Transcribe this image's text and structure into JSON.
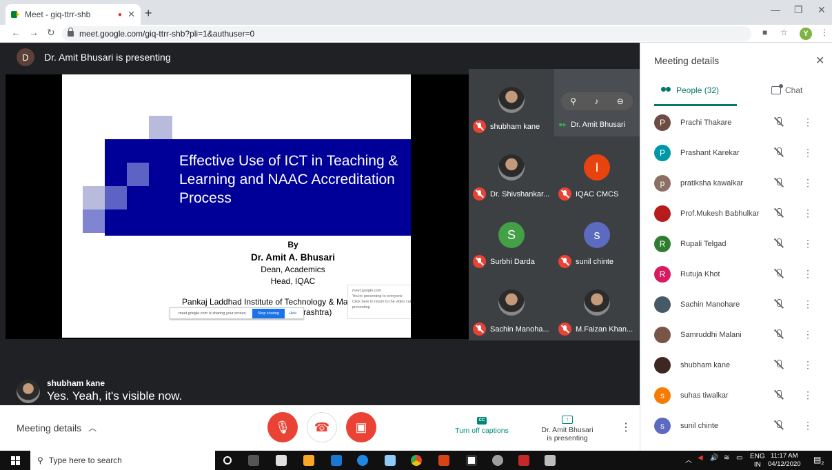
{
  "browser": {
    "tab_title": "Meet - giq-ttrr-shb",
    "url": "meet.google.com/giq-ttrr-shb?pli=1&authuser=0",
    "avatar_letter": "Y"
  },
  "meeting": {
    "presenter_initial": "D",
    "presenter_text": "Dr. Amit Bhusari is presenting"
  },
  "slide": {
    "title": "Effective Use of ICT in Teaching & Learning and NAAC Accreditation Process",
    "by": "By",
    "author": "Dr. Amit A. Bhusari",
    "role1": "Dean, Academics",
    "role2": "Head, IQAC",
    "institute": "Pankaj Laddhad Institute of Technology & Man",
    "institute_tail": "rashtra)",
    "share_text": "meet.google.com is sharing your screen.",
    "stop_label": "Stop sharing",
    "hide_label": "Hide",
    "popup_site": "meet.google.com",
    "popup_line1": "You're presenting to everyone",
    "popup_line2": "Click here to return to the video call when you're ready to stop presenting"
  },
  "tiles": [
    {
      "name": "shubham kane",
      "initial": "",
      "color": "photo"
    },
    {
      "name": "Dr. Amit Bhusari",
      "initial": "",
      "color": "speaker"
    },
    {
      "name": "Dr. Shivshankar...",
      "initial": "",
      "color": "photo"
    },
    {
      "name": "IQAC CMCS",
      "initial": "I",
      "color": "#e8430f"
    },
    {
      "name": "Surbhi Darda",
      "initial": "S",
      "color": "#43a047"
    },
    {
      "name": "sunil chinte",
      "initial": "s",
      "color": "#5c6bc0"
    },
    {
      "name": "Sachin Manoha...",
      "initial": "",
      "color": "photo"
    },
    {
      "name": "M.Faizan Khan...",
      "initial": "",
      "color": "photo"
    }
  ],
  "caption": {
    "speaker": "shubham kane",
    "text": "Yes. Yeah, it's visible now."
  },
  "controls": {
    "meeting_details": "Meeting details",
    "captions_label": "Turn off captions",
    "cc_icon": "CC",
    "presenting_line1": "Dr. Amit Bhusari",
    "presenting_line2": "is presenting"
  },
  "panel": {
    "title": "Meeting details",
    "people_tab": "People (32)",
    "chat_tab": "Chat",
    "people": [
      {
        "name": "Prachi Thakare",
        "initial": "P",
        "color": "#6d4c41"
      },
      {
        "name": "Prashant Karekar",
        "initial": "P",
        "color": "#0097a7"
      },
      {
        "name": "pratiksha kawalkar",
        "initial": "p",
        "color": "#8d6e63"
      },
      {
        "name": "Prof.Mukesh Babhulkar",
        "initial": "",
        "color": "#b71c1c"
      },
      {
        "name": "Rupali Telgad",
        "initial": "R",
        "color": "#2e7d32"
      },
      {
        "name": "Rutuja Khot",
        "initial": "R",
        "color": "#d81b60"
      },
      {
        "name": "Sachin Manohare",
        "initial": "",
        "color": "#455a64"
      },
      {
        "name": "Samruddhi Malani",
        "initial": "",
        "color": "#795548"
      },
      {
        "name": "shubham kane",
        "initial": "",
        "color": "#3e2723"
      },
      {
        "name": "suhas tiwalkar",
        "initial": "s",
        "color": "#f57c00"
      },
      {
        "name": "sunil chinte",
        "initial": "s",
        "color": "#5c6bc0"
      }
    ]
  },
  "taskbar": {
    "search_placeholder": "Type here to search",
    "lang_top": "ENG",
    "lang_bottom": "IN",
    "time": "11:17 AM",
    "date": "04/12/2020",
    "notif_count": "2"
  }
}
